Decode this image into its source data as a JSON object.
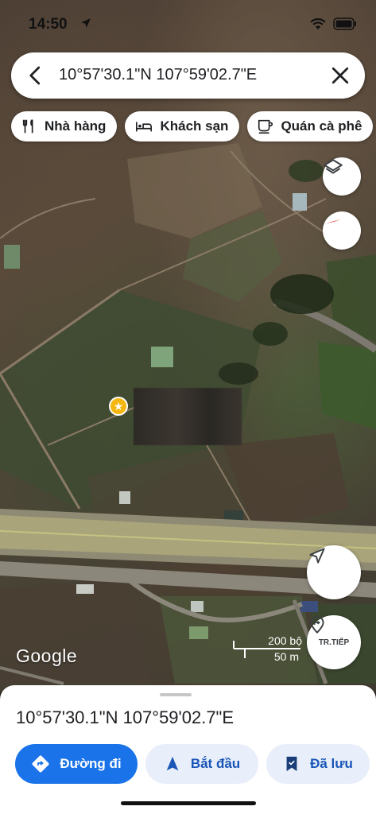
{
  "status_bar": {
    "time": "14:50"
  },
  "search": {
    "query": "10°57'30.1\"N 107°59'02.7\"E"
  },
  "chips": [
    {
      "label": "Nhà hàng",
      "icon": "restaurant-icon"
    },
    {
      "label": "Khách sạn",
      "icon": "hotel-icon"
    },
    {
      "label": "Quán cà phê",
      "icon": "coffee-icon"
    }
  ],
  "map": {
    "logo": "Google",
    "scale_imperial": "200 bộ",
    "scale_metric": "50 m",
    "directions_fab_label": "TR.TIẾP"
  },
  "place": {
    "coordinates": "10°57'30.1\"N 107°59'02.7\"E"
  },
  "actions": {
    "directions": "Đường đi",
    "start": "Bắt đầu",
    "saved": "Đã lưu"
  },
  "colors": {
    "primary": "#1a73e8",
    "secondary_bg": "#e8eefa",
    "star": "#f5b70f"
  }
}
